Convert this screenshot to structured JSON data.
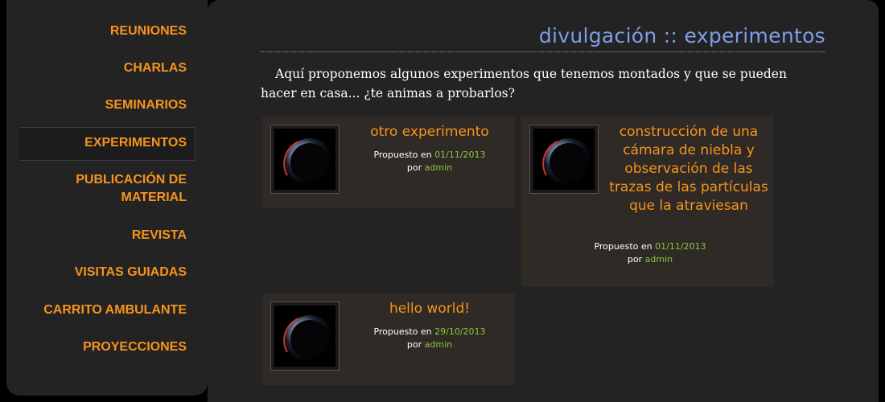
{
  "sidebar": {
    "items": [
      {
        "label": "REUNIONES"
      },
      {
        "label": "CHARLAS"
      },
      {
        "label": "SEMINARIOS"
      },
      {
        "label": "EXPERIMENTOS"
      },
      {
        "label": "PUBLICACIÓN DE MATERIAL"
      },
      {
        "label": "REVISTA"
      },
      {
        "label": "VISITAS GUIADAS"
      },
      {
        "label": "CARRITO AMBULANTE"
      },
      {
        "label": "PROYECCIONES"
      }
    ],
    "active": "EXPERIMENTOS"
  },
  "main": {
    "title": "divulgación :: experimentos",
    "intro": "Aquí proponemos algunos experimentos que tenemos montados y que se pueden hacer en casa... ¿te animas a probarlos?",
    "posts": [
      {
        "title": "otro experimento",
        "proposed_label": "Propuesto en",
        "date": "01/11/2013",
        "by_label": "por",
        "author": "admin"
      },
      {
        "title": "construcción de una cámara de niebla y observación de las trazas de las partículas que la atraviesan",
        "proposed_label": "Propuesto en",
        "date": "01/11/2013",
        "by_label": "por",
        "author": "admin"
      },
      {
        "title": "hello world!",
        "proposed_label": "Propuesto en",
        "date": "29/10/2013",
        "by_label": "por",
        "author": "admin"
      }
    ]
  },
  "colors": {
    "accent": "#f7931e",
    "title": "#7e9ee8",
    "link_green": "#8cc63f",
    "panel": "#232323",
    "card": "#2f2a25"
  }
}
